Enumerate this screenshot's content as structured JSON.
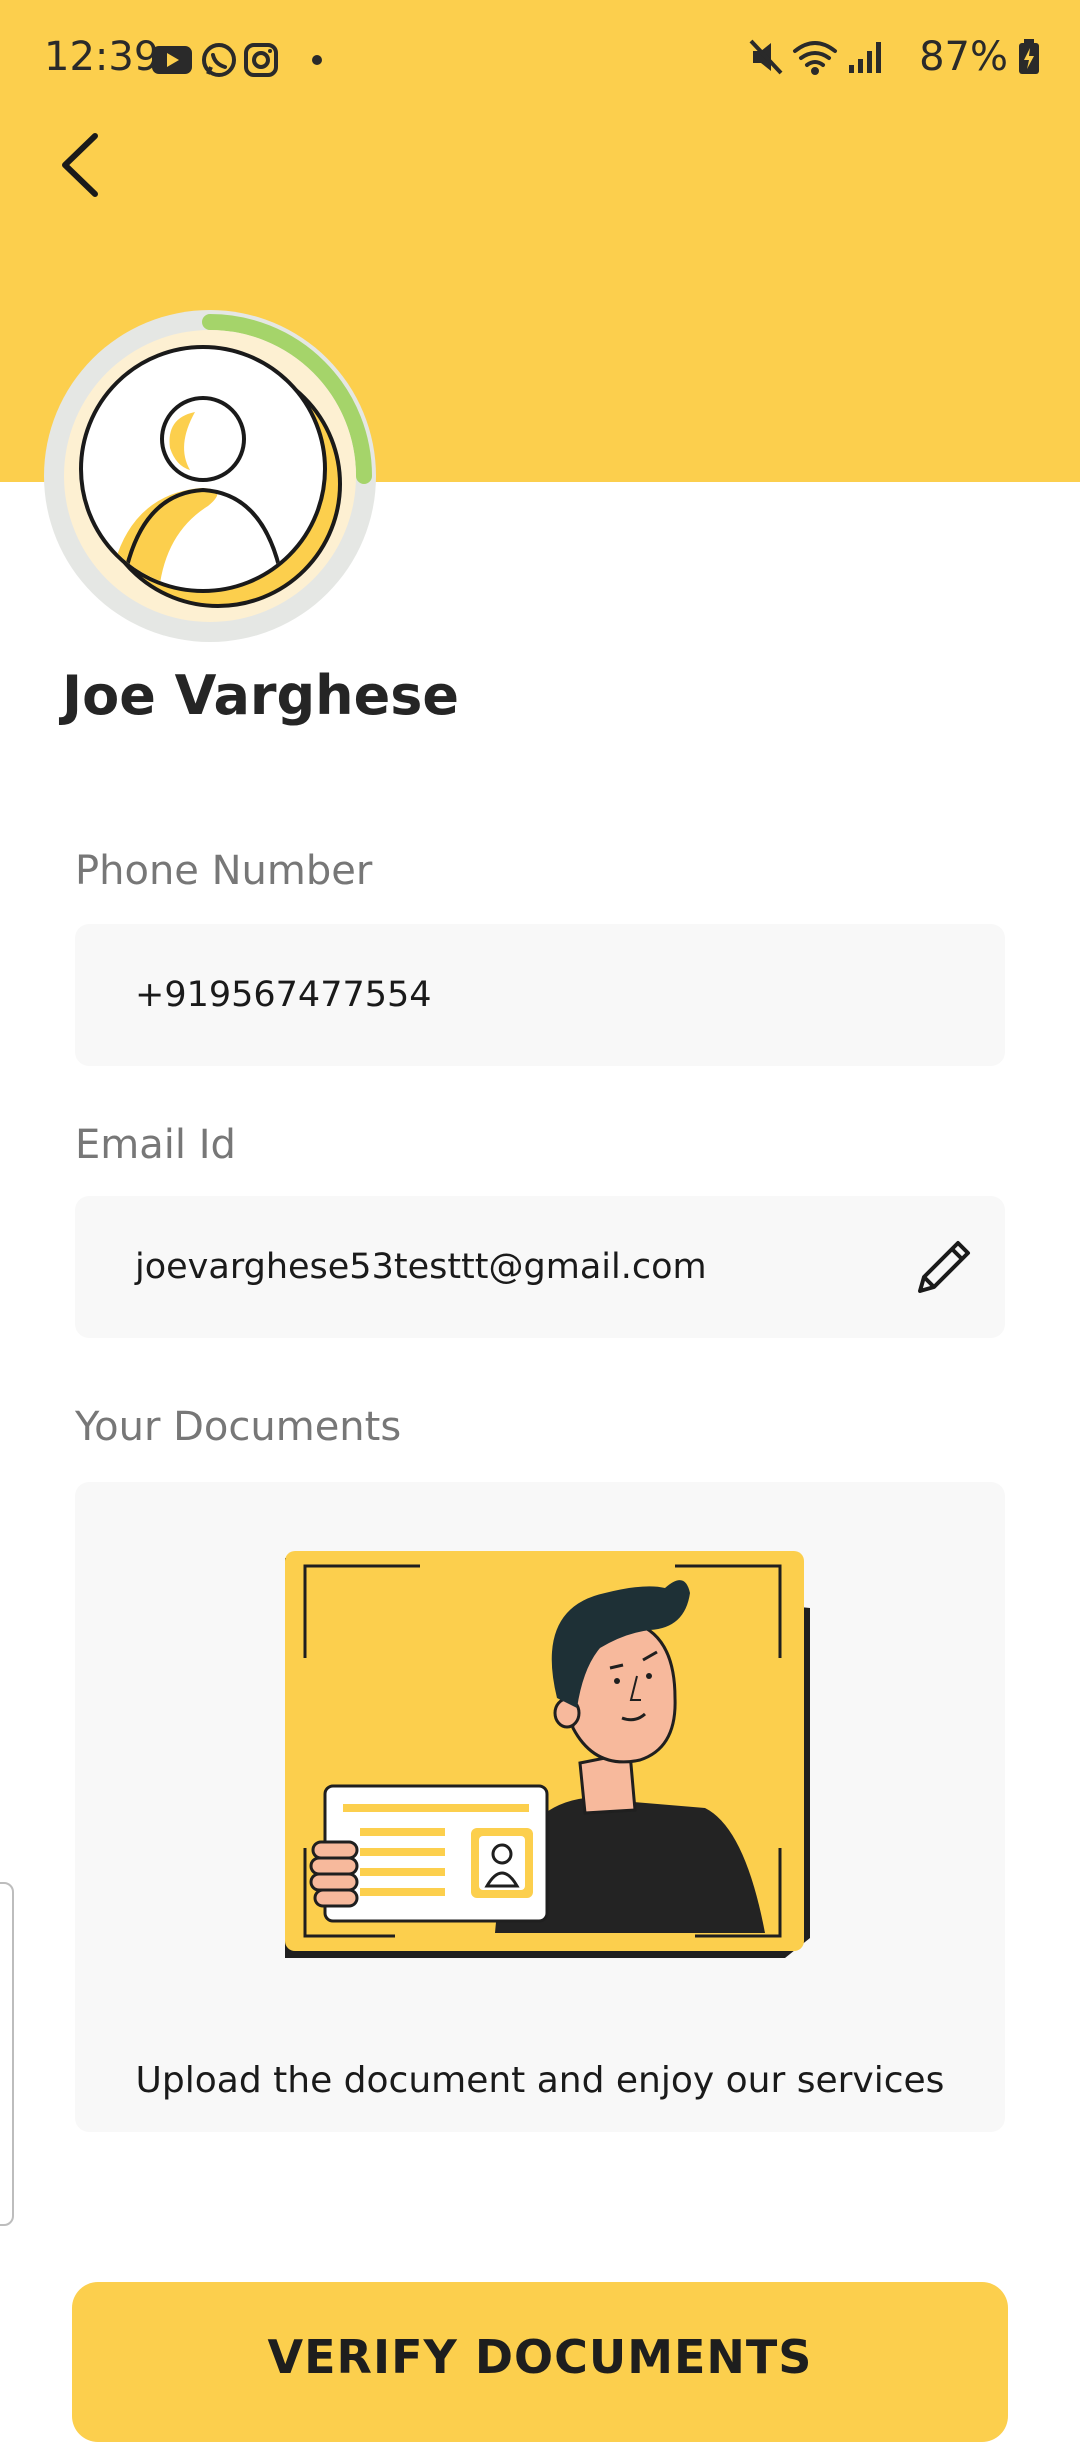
{
  "status_bar": {
    "time": "12:39",
    "battery": "87%",
    "left_icons": [
      "youtube-icon",
      "whatsapp-icon",
      "instagram-icon",
      "dot-icon"
    ],
    "right_icons": [
      "mute-icon",
      "wifi-icon",
      "signal-icon",
      "battery-icon"
    ]
  },
  "header": {
    "back_icon": "back-arrow-icon"
  },
  "profile": {
    "name": "Joe Varghese",
    "avatar_icon": "user-avatar-icon"
  },
  "phone": {
    "label": "Phone Number",
    "value": "+919567477554"
  },
  "email": {
    "label": "Email Id",
    "value": "joevarghese53testtt@gmail.com",
    "edit_icon": "pencil-icon"
  },
  "documents": {
    "label": "Your Documents",
    "caption": "Upload the document and enjoy our services",
    "illustration": "id-card-illustration"
  },
  "verify_button": {
    "label": "VERIFY DOCUMENTS"
  },
  "colors": {
    "accent": "#FCCF4D",
    "progress": "#A5D46A",
    "field_bg": "#F8F8F8"
  }
}
